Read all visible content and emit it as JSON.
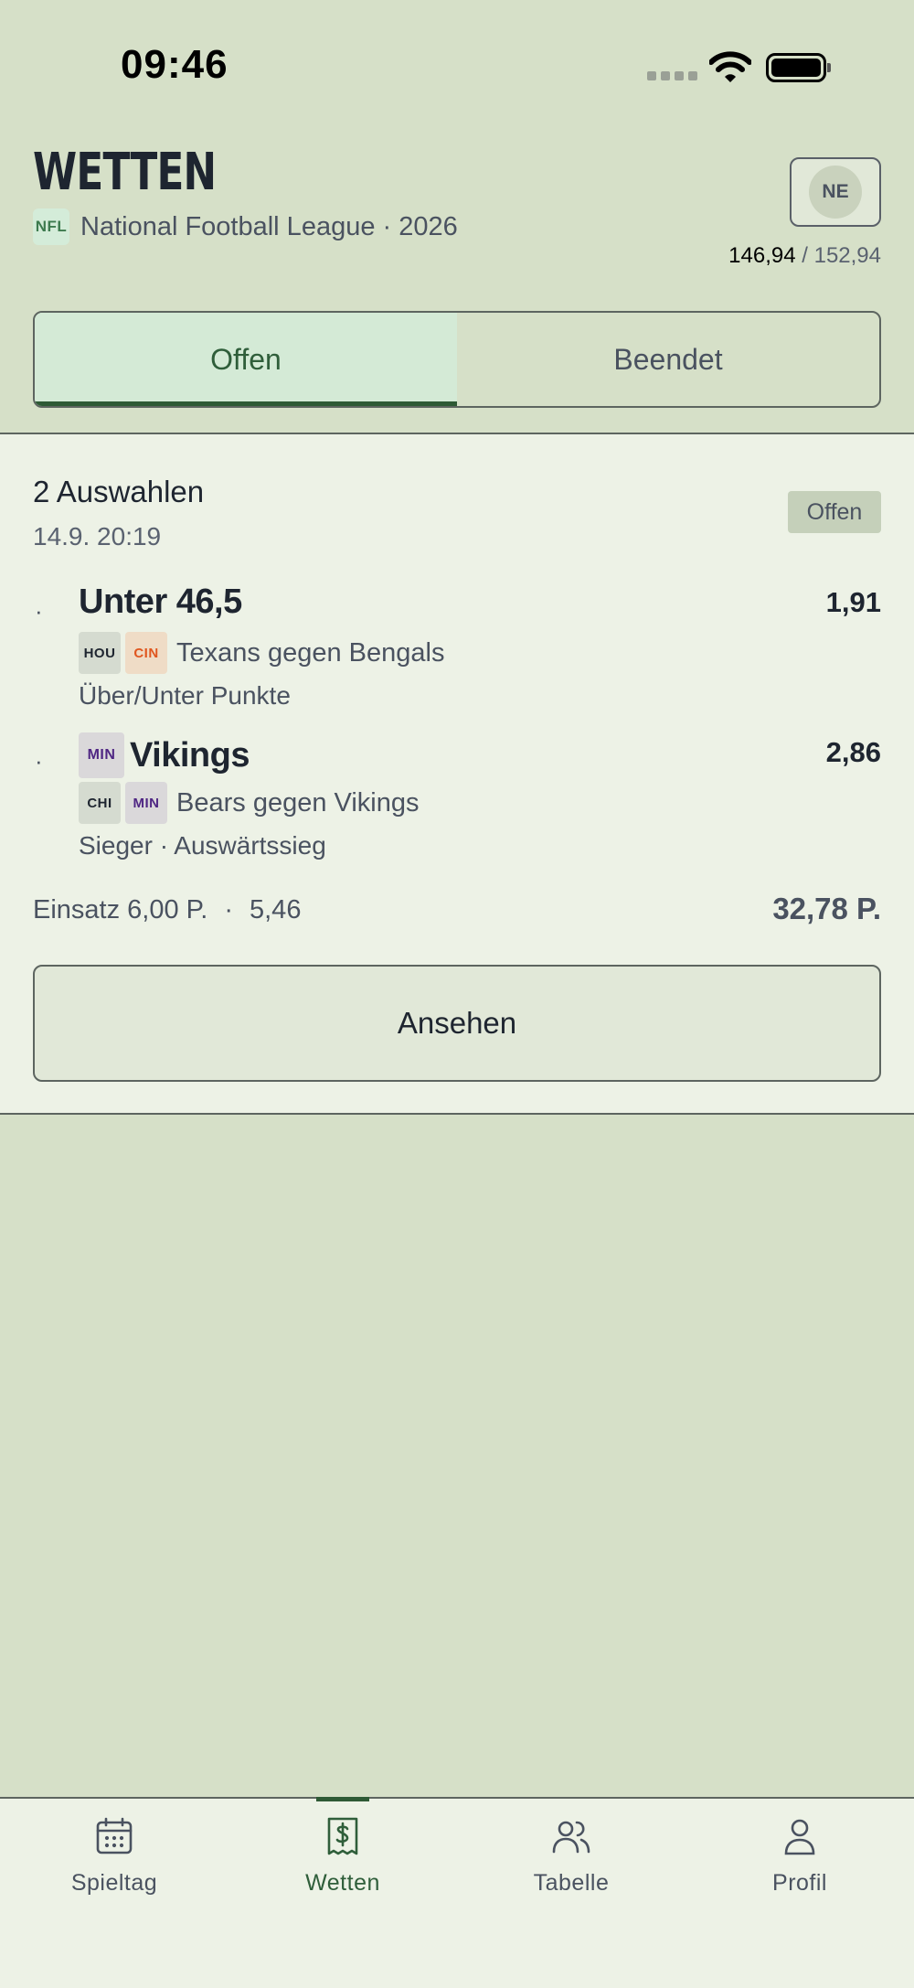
{
  "status_bar": {
    "time": "09:46"
  },
  "header": {
    "title": "WETTEN",
    "league_badge": "NFL",
    "league_text": "National Football League · 2026",
    "avatar_initials": "NE",
    "points_current": "146,94",
    "points_total": "152,94"
  },
  "tabs": [
    {
      "label": "Offen",
      "active": true
    },
    {
      "label": "Beendet",
      "active": false
    }
  ],
  "bet": {
    "title": "2 Auswahlen",
    "date": "14.9.  20:19",
    "status": "Offen",
    "selections": [
      {
        "title": "Unter 46,5",
        "odds": "1,91",
        "teams": [
          {
            "abbr": "HOU",
            "bg": "#d5dbd0",
            "color": "#1e2530"
          },
          {
            "abbr": "CIN",
            "bg": "#efdcc6",
            "color": "#e0561f"
          }
        ],
        "match": "Texans gegen Bengals",
        "market": "Über/Unter Punkte"
      },
      {
        "title": "Vikings",
        "odds": "2,86",
        "title_team": {
          "abbr": "MIN",
          "bg": "#dad8da",
          "color": "#4f2683"
        },
        "teams": [
          {
            "abbr": "CHI",
            "bg": "#d5dbd0",
            "color": "#1e2530"
          },
          {
            "abbr": "MIN",
            "bg": "#dad8da",
            "color": "#4f2683"
          }
        ],
        "match": "Bears gegen Vikings",
        "market": "Sieger · Auswärtssieg"
      }
    ],
    "stake": "Einsatz 6,00 P.",
    "separator": "·",
    "total_odds": "5,46",
    "payout": "32,78 P.",
    "view_button": "Ansehen"
  },
  "bottom_nav": [
    {
      "label": "Spieltag",
      "icon": "calendar-icon",
      "active": false
    },
    {
      "label": "Wetten",
      "icon": "receipt-dollar-icon",
      "active": true
    },
    {
      "label": "Tabelle",
      "icon": "users-icon",
      "active": false
    },
    {
      "label": "Profil",
      "icon": "user-icon",
      "active": false
    }
  ],
  "colors": {
    "accent": "#2e5a35",
    "background": "#d6e0c8",
    "card": "#edf2e6"
  }
}
